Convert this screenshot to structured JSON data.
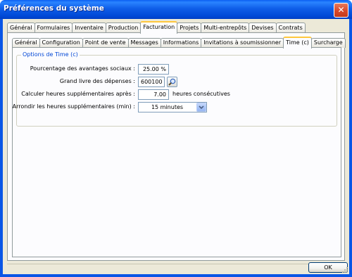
{
  "window": {
    "title": "Préférences du système",
    "close_glyph": "✕"
  },
  "outer_tabs": [
    {
      "label": "Général"
    },
    {
      "label": "Formulaires"
    },
    {
      "label": "Inventaire"
    },
    {
      "label": "Production"
    },
    {
      "label": "Facturation",
      "active": true
    },
    {
      "label": "Projets"
    },
    {
      "label": "Multi-entrepôts"
    },
    {
      "label": "Devises"
    },
    {
      "label": "Contrats"
    }
  ],
  "inner_tabs": [
    {
      "label": "Général"
    },
    {
      "label": "Configuration"
    },
    {
      "label": "Point de vente"
    },
    {
      "label": "Messages"
    },
    {
      "label": "Informations"
    },
    {
      "label": "Invitations à soumissionner"
    },
    {
      "label": "Time (c)",
      "active": true
    },
    {
      "label": "Surcharge"
    }
  ],
  "group": {
    "title": "Options de Time (c)",
    "fields": {
      "social_benefits": {
        "label": "Pourcentage des avantages sociaux :",
        "value": "25.00 %"
      },
      "gl_expenses": {
        "label": "Grand livre des dépenses :",
        "value": "600100",
        "lookup_icon": "magnifier-icon"
      },
      "overtime_after": {
        "label": "Calculer heures supplémentaires après :",
        "value": "7.00",
        "suffix": "heures consécutives"
      },
      "round_overtime": {
        "label": "Arrondir les heures supplémentaires (min) :",
        "value": "15 minutes"
      }
    }
  },
  "footer": {
    "ok_label": "OK"
  },
  "colors": {
    "titlebar": "#0a56e6",
    "group_title": "#0046d5",
    "active_tab_accent": "#ffc73c"
  }
}
